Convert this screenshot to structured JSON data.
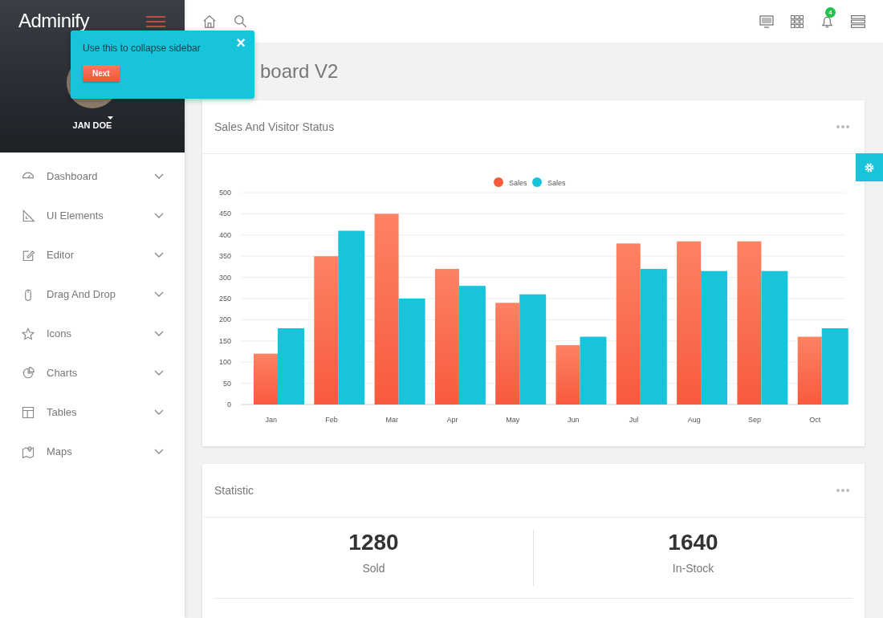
{
  "sidebar": {
    "brand": "Adminify",
    "user": "JAN DOE",
    "items": [
      {
        "label": "Dashboard"
      },
      {
        "label": "UI Elements"
      },
      {
        "label": "Editor"
      },
      {
        "label": "Drag And Drop"
      },
      {
        "label": "Icons"
      },
      {
        "label": "Charts"
      },
      {
        "label": "Tables"
      },
      {
        "label": "Maps"
      }
    ]
  },
  "topbar": {
    "notification_count": "4"
  },
  "tour_popup": {
    "text": "Use this to collapse sidebar",
    "button": "Next",
    "close": "×"
  },
  "page_title": "board V2",
  "sales_card": {
    "title": "Sales And Visitor Status",
    "chart_data": {
      "type": "bar",
      "categories": [
        "Jan",
        "Feb",
        "Mar",
        "Apr",
        "May",
        "Jun",
        "Jul",
        "Aug",
        "Sep",
        "Oct"
      ],
      "series": [
        {
          "name": "Sales",
          "color": "#f85a3e",
          "values": [
            120,
            350,
            450,
            320,
            240,
            140,
            380,
            385,
            385,
            160
          ]
        },
        {
          "name": "Sales",
          "color": "#17c4dc",
          "values": [
            180,
            410,
            250,
            280,
            260,
            160,
            320,
            315,
            315,
            180
          ]
        }
      ],
      "ylim": [
        0,
        500
      ],
      "grid": true,
      "yticks": [
        0,
        50,
        100,
        150,
        200,
        250,
        300,
        350,
        400,
        450,
        500
      ]
    }
  },
  "statistic_card": {
    "title": "Statistic",
    "stats": [
      {
        "value": "1280",
        "label": "Sold"
      },
      {
        "value": "1640",
        "label": "In-Stock"
      }
    ]
  }
}
